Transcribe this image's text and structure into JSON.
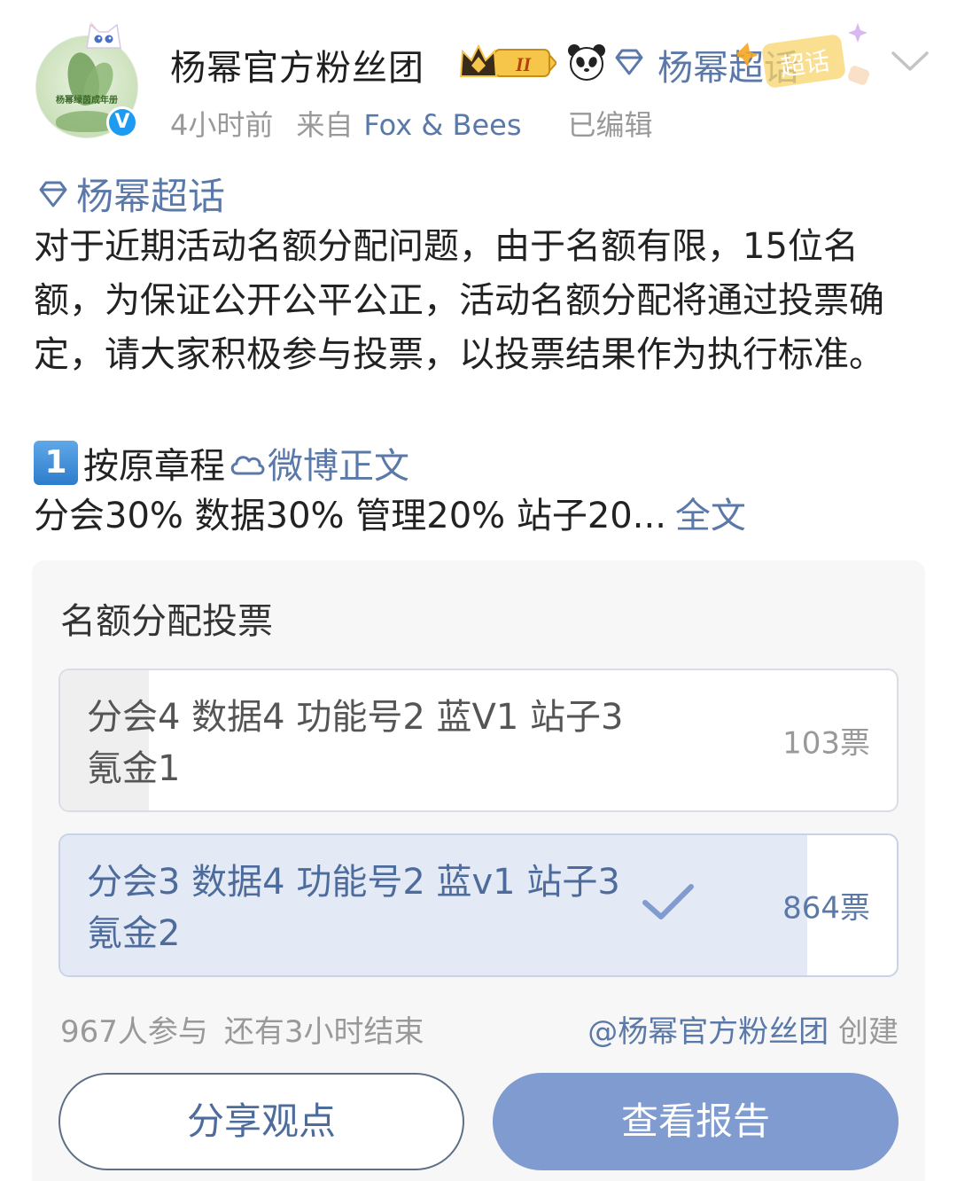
{
  "header": {
    "username": "杨幂官方粉丝团",
    "level_badge": "II",
    "topic_name": "杨幂超话",
    "superchat_badge": "超话",
    "avatar_caption": "杨幂绿茵成年册",
    "verified_mark": "V"
  },
  "meta": {
    "time": "4小时前",
    "source_prefix": "来自",
    "source_name": "Fox & Bees",
    "edited": "已编辑"
  },
  "post": {
    "topic_link": "杨幂超话",
    "body": "对于近期活动名额分配问题，由于名额有限，15位名额，为保证公开公平公正，活动名额分配将通过投票确定，请大家积极参与投票，以投票结果作为执行标准。",
    "rule_number": "1",
    "rule_text": "按原章程",
    "weibo_link": "微博正文",
    "percent_line": "分会30% 数据30% 管理20% 站子20...",
    "more_link": "全文"
  },
  "poll": {
    "title": "名额分配投票",
    "options": [
      {
        "label": "分会4 数据4 功能号2 蓝V1 站子3 氪金1",
        "votes": "103票",
        "share": 0.106,
        "selected": false
      },
      {
        "label": "分会3 数据4 功能号2 蓝v1 站子3 氪金2",
        "votes": "864票",
        "share": 0.893,
        "selected": true
      }
    ],
    "participants": "967人参与",
    "remaining": "还有3小时结束",
    "creator": "@杨幂官方粉丝团",
    "created_suffix": "创建"
  },
  "buttons": {
    "share": "分享观点",
    "report": "查看报告"
  },
  "colors": {
    "link_blue": "#5b79a8",
    "primary_button": "#7f9bcf",
    "selected_fill": "#e3eaf6",
    "verified_blue": "#1d9bf0"
  }
}
